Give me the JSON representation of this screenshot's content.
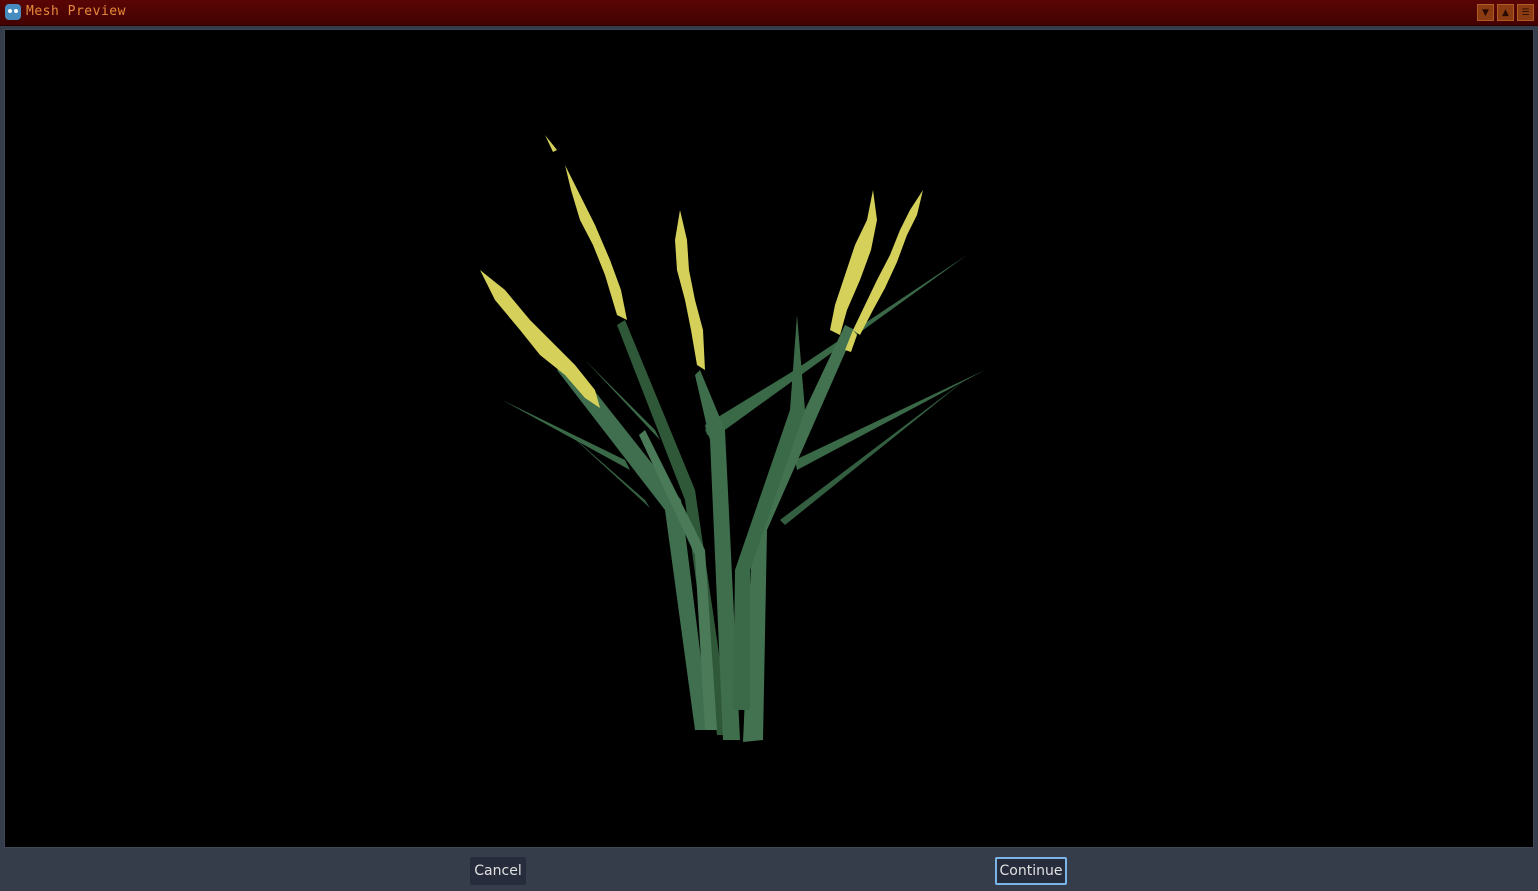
{
  "window": {
    "title": "Mesh Preview",
    "icon": "godot-engine-icon",
    "controls": [
      "minimize-icon",
      "maximize-icon",
      "menu-icon"
    ],
    "titlebar_color": "#4d0303",
    "title_color": "#e88a3a"
  },
  "viewport": {
    "content": "grass-mesh-preview",
    "background": "#000000",
    "blade_color": "#3f6f4d",
    "blade_dark_color": "#2c5236",
    "seed_color": "#d4d05a"
  },
  "footer": {
    "cancel_label": "Cancel",
    "continue_label": "Continue",
    "focus_color": "#7bb5e8"
  }
}
